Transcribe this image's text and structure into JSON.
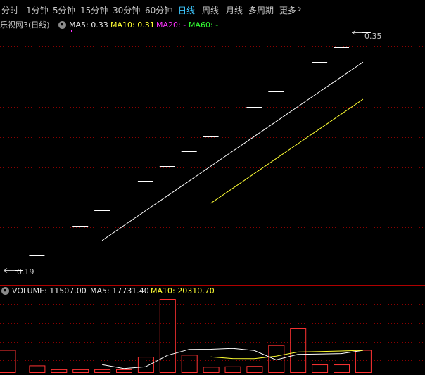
{
  "tabs": [
    {
      "label": "分时",
      "active": false
    },
    {
      "label": "1分钟",
      "active": false
    },
    {
      "label": "5分钟",
      "active": false
    },
    {
      "label": "15分钟",
      "active": false
    },
    {
      "label": "30分钟",
      "active": false
    },
    {
      "label": "60分钟",
      "active": false
    },
    {
      "label": "日线",
      "active": true
    },
    {
      "label": "周线",
      "active": false
    },
    {
      "label": "月线",
      "active": false
    },
    {
      "label": "多周期",
      "active": false
    },
    {
      "label": "更多",
      "active": false
    }
  ],
  "more_arrow": "›",
  "price_legend": {
    "title": "乐视网3(日线)",
    "ma5": "MA5: 0.33",
    "ma10": "MA10: 0.31",
    "ma20": "MA20: -",
    "ma60": "MA60: -"
  },
  "volume_legend": {
    "volume": "VOLUME: 11507.00",
    "ma5": "MA5: 17731.40",
    "ma10": "MA10: 20310.70"
  },
  "price_markers": {
    "high": "0.35",
    "low": "0.19"
  },
  "colors": {
    "up": "#ff3333",
    "ma5": "#ffffff",
    "ma10": "#ffff33",
    "ma20": "#ff33ff",
    "ma60": "#33ff33",
    "grid": "#8a0000",
    "active_tab": "#3fc8ff",
    "background": "#000000"
  },
  "chart_data": {
    "type": "candlestick",
    "price_range": [
      0.19,
      0.35
    ],
    "candles": [
      {
        "open": 0.19,
        "close": 0.19
      },
      {
        "open": 0.2,
        "close": 0.2
      },
      {
        "open": 0.21,
        "close": 0.21
      },
      {
        "open": 0.22,
        "close": 0.22
      },
      {
        "open": 0.23,
        "close": 0.23
      },
      {
        "open": 0.24,
        "close": 0.24
      },
      {
        "open": 0.25,
        "close": 0.25
      },
      {
        "open": 0.26,
        "close": 0.26
      },
      {
        "open": 0.27,
        "close": 0.27
      },
      {
        "open": 0.28,
        "close": 0.28
      },
      {
        "open": 0.29,
        "close": 0.29
      },
      {
        "open": 0.3,
        "close": 0.3
      },
      {
        "open": 0.31,
        "close": 0.31
      },
      {
        "open": 0.32,
        "close": 0.32
      },
      {
        "open": 0.33,
        "close": 0.33
      },
      {
        "open": 0.34,
        "close": 0.34
      },
      {
        "open": 0.35,
        "close": 0.35
      }
    ],
    "ma5": [
      null,
      null,
      null,
      null,
      0.21,
      0.22,
      0.23,
      0.24,
      0.25,
      0.26,
      0.27,
      0.28,
      0.29,
      0.3,
      0.31,
      0.32,
      0.33
    ],
    "ma10": [
      null,
      null,
      null,
      null,
      null,
      null,
      null,
      null,
      null,
      0.235,
      0.245,
      0.255,
      0.265,
      0.275,
      0.285,
      0.295,
      0.305
    ],
    "volume": [
      11500,
      3500,
      1500,
      1500,
      1500,
      1500,
      8000,
      38000,
      9000,
      2800,
      3000,
      3200,
      14000,
      23000,
      4000,
      4000,
      11507
    ],
    "volume_ma5": [
      null,
      null,
      null,
      null,
      3900,
      1900,
      2800,
      8700,
      11800,
      11860,
      12360,
      11200,
      6400,
      9200,
      9440,
      9640,
      11301
    ],
    "volume_ma10": [
      null,
      null,
      null,
      null,
      null,
      null,
      null,
      null,
      null,
      7930,
      7080,
      7050,
      8300,
      10450,
      10700,
      10950,
      11300
    ]
  }
}
